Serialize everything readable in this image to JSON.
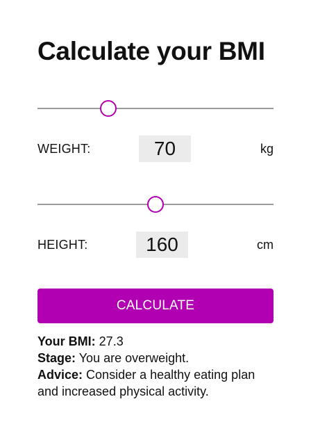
{
  "page": {
    "title": "Calculate your BMI"
  },
  "weight": {
    "label": "WEIGHT:",
    "value": "70",
    "unit": "kg",
    "slider_fraction": 0.3
  },
  "height": {
    "label": "HEIGHT:",
    "value": "160",
    "unit": "cm",
    "slider_fraction": 0.5
  },
  "calculate_button": {
    "label": "CALCULATE"
  },
  "result": {
    "bmi_label": "Your BMI:",
    "bmi_value": "27.3",
    "stage_label": "Stage:",
    "stage_value": "You are overweight.",
    "advice_label": "Advice:",
    "advice_value": "Consider a healthy eating plan and increased physical activity."
  },
  "colors": {
    "accent": "#b100b1",
    "track": "#9a9a9a",
    "value_box": "#ebebeb"
  }
}
